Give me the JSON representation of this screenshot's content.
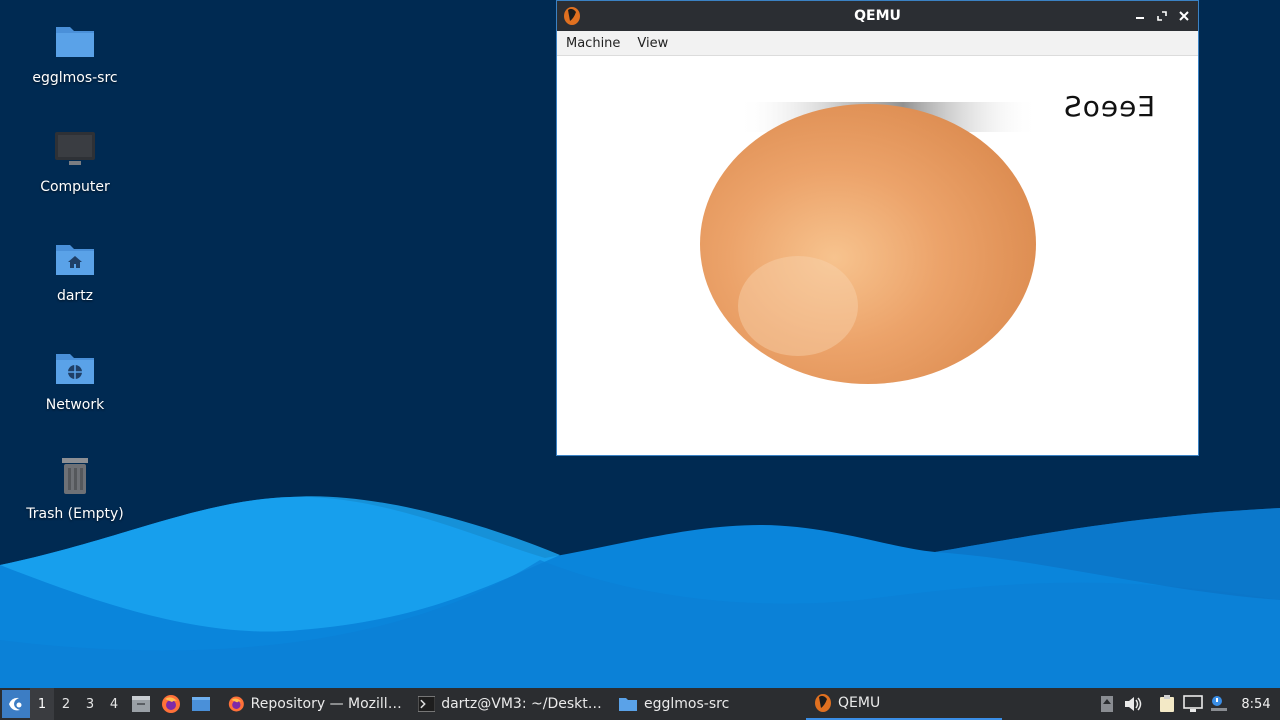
{
  "desktop": {
    "icons": [
      {
        "label": "egglmos-src",
        "icon": "folder-icon"
      },
      {
        "label": "Computer",
        "icon": "computer-icon"
      },
      {
        "label": "dartz",
        "icon": "home-folder-icon"
      },
      {
        "label": "Network",
        "icon": "network-folder-icon"
      },
      {
        "label": "Trash (Empty)",
        "icon": "trash-icon"
      }
    ]
  },
  "qemu_window": {
    "title": "QEMU",
    "menu": [
      "Machine",
      "View"
    ],
    "controls": [
      "minimize-icon",
      "maximize-icon",
      "close-icon"
    ],
    "screen": {
      "text": "EeeoS",
      "content": "egg-image"
    }
  },
  "taskbar": {
    "workspaces": [
      "1",
      "2",
      "3",
      "4"
    ],
    "active_workspace": "1",
    "quick_launch": [
      "file-manager-icon",
      "firefox-icon",
      "desktop-icon"
    ],
    "tasks": [
      {
        "label": "Repository — Mozilla ...",
        "icon": "firefox-icon"
      },
      {
        "label": "dartz@VM3: ~/Deskto...",
        "icon": "terminal-icon"
      },
      {
        "label": "egglmos-src",
        "icon": "folder-icon"
      },
      {
        "label": "QEMU",
        "icon": "qemu-icon",
        "active": true
      }
    ],
    "tray": [
      "update-icon",
      "volume-icon",
      "clipboard-icon",
      "network-icon",
      "notification-icon"
    ],
    "clock": "8:54"
  },
  "colors": {
    "wallpaper_dark": "#002a52",
    "wave_light": "#0a90e6",
    "taskbar": "#2b2d30",
    "accent": "#3a8ee6"
  }
}
